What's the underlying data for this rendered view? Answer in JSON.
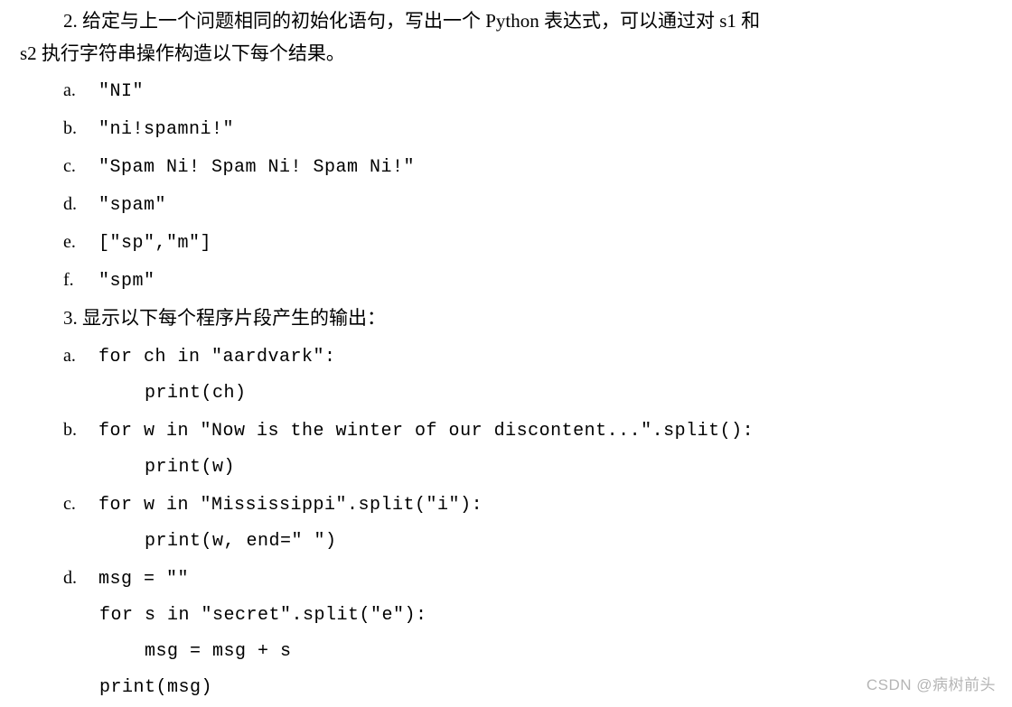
{
  "q2": {
    "intro_part1": "2.  给定与上一个问题相同的初始化语句，写出一个 Python 表达式，可以通过对 s1 和",
    "intro_part2": "s2 执行字符串操作构造以下每个结果。",
    "items": [
      {
        "label": "a.",
        "text": "\"NI\""
      },
      {
        "label": "b.",
        "text": "\"ni!spamni!\""
      },
      {
        "label": "c.",
        "text": "\"Spam Ni! Spam Ni! Spam Ni!\""
      },
      {
        "label": "d.",
        "text": "\"spam\""
      },
      {
        "label": "e.",
        "text": "[\"sp\",\"m\"]"
      },
      {
        "label": "f.",
        "text": "\"spm\""
      }
    ]
  },
  "q3": {
    "intro": "3.  显示以下每个程序片段产生的输出：",
    "a": {
      "label": "a.",
      "line1": "for ch in \"aardvark\":",
      "line2": "print(ch)"
    },
    "b": {
      "label": "b.",
      "line1": "for w in \"Now is the winter of our discontent...\".split():",
      "line2": "print(w)"
    },
    "c": {
      "label": "c.",
      "line1": "for w in \"Mississippi\".split(\"i\"):",
      "line2": "print(w, end=\" \")"
    },
    "d": {
      "label": "d.",
      "line1": "msg = \"\"",
      "line2": "for s in \"secret\".split(\"e\"):",
      "line3": "msg = msg + s",
      "line4": "print(msg)"
    }
  },
  "watermark": "CSDN @病树前头"
}
